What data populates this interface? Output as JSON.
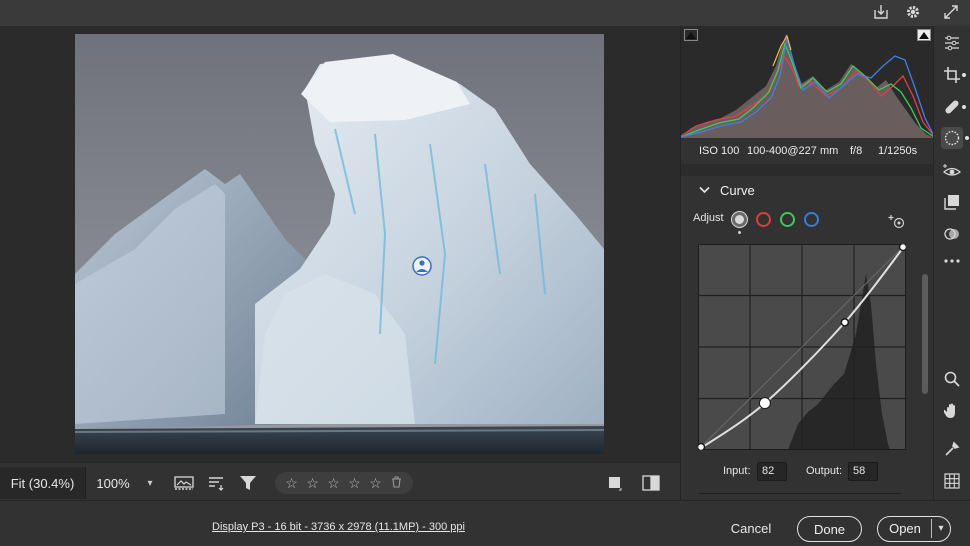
{
  "topbar": {
    "icons": [
      "save-icon",
      "gear-icon",
      "expand-icon"
    ]
  },
  "bottom_toolbar": {
    "zoom_fit_label": "Fit (30.4%)",
    "zoom_100_label": "100%",
    "zoom_dropdown_icon": "chevron-down-icon",
    "rating_stars": 5,
    "rating_value": 0
  },
  "histogram": {
    "iso": "ISO 100",
    "lens": "100-400@227 mm",
    "aperture": "f/8",
    "shutter": "1/1250s"
  },
  "curve": {
    "title": "Curve",
    "adjust_label": "Adjust",
    "channels": [
      {
        "name": "parametric",
        "color": "#d9d9d9"
      },
      {
        "name": "red",
        "color": "#e23a3a"
      },
      {
        "name": "green",
        "color": "#3cc85a"
      },
      {
        "name": "blue",
        "color": "#3a7be0"
      }
    ],
    "input_label": "Input:",
    "input_value": "82",
    "output_label": "Output:",
    "output_value": "58",
    "points": [
      [
        0,
        0
      ],
      [
        82,
        58
      ],
      [
        180,
        158
      ],
      [
        255,
        255
      ]
    ]
  },
  "status": {
    "file_info": "Display P3 - 16 bit - 3736 x 2978 (11.1MP) - 300 ppi",
    "cancel_label": "Cancel",
    "done_label": "Done",
    "open_label": "Open"
  },
  "tools": [
    "edit-icon",
    "crop-icon",
    "healing-icon",
    "masking-icon",
    "red-eye-icon",
    "snapshots-icon",
    "presets-icon",
    "more-icon",
    "zoom-icon",
    "hand-icon",
    "white-balance-icon",
    "grid-icon"
  ]
}
